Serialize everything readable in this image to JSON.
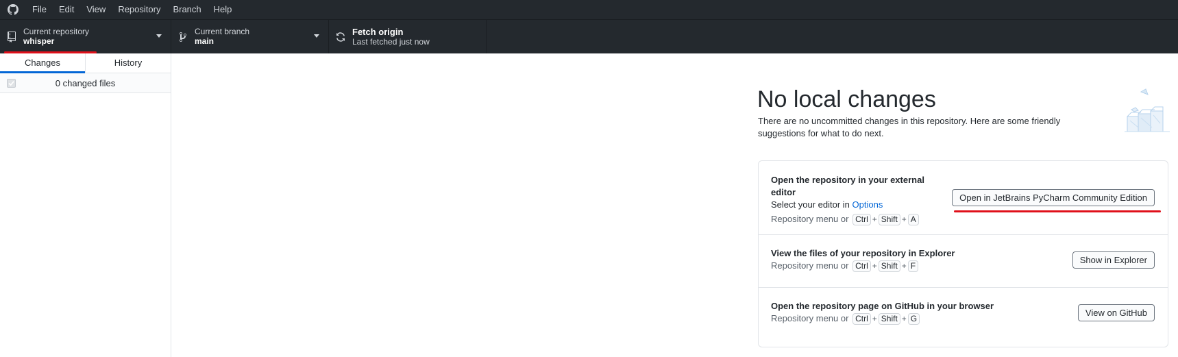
{
  "menu": {
    "items": [
      "File",
      "Edit",
      "View",
      "Repository",
      "Branch",
      "Help"
    ]
  },
  "toolbar": {
    "repository": {
      "label": "Current repository",
      "value": "whisper"
    },
    "branch": {
      "label": "Current branch",
      "value": "main"
    },
    "fetch": {
      "label": "Fetch origin",
      "sub": "Last fetched just now"
    }
  },
  "sidebar": {
    "tabs": [
      {
        "label": "Changes",
        "active": true
      },
      {
        "label": "History",
        "active": false
      }
    ],
    "changed_files_label": "0 changed files"
  },
  "main": {
    "heading": "No local changes",
    "description": "There are no uncommitted changes in this repository. Here are some friendly suggestions for what to do next.",
    "actions": [
      {
        "title": "Open the repository in your external editor",
        "text_prefix": "Select your editor in ",
        "link": "Options",
        "hint_prefix": "Repository menu or",
        "keys": [
          "Ctrl",
          "Shift",
          "A"
        ],
        "button": "Open in JetBrains PyCharm Community Edition"
      },
      {
        "title": "View the files of your repository in Explorer",
        "hint_prefix": "Repository menu or",
        "keys": [
          "Ctrl",
          "Shift",
          "F"
        ],
        "button": "Show in Explorer"
      },
      {
        "title": "Open the repository page on GitHub in your browser",
        "hint_prefix": "Repository menu or",
        "keys": [
          "Ctrl",
          "Shift",
          "G"
        ],
        "button": "View on GitHub"
      }
    ],
    "key_separator": "+"
  },
  "colors": {
    "toolbar_bg": "#24292e",
    "accent": "#0366d6",
    "annotation_red": "#e0101a"
  },
  "icons": [
    "github-logo-icon",
    "repo-icon",
    "branch-icon",
    "sync-icon",
    "chevron-down-icon",
    "checkbox-icon",
    "blankslate-illustration"
  ]
}
